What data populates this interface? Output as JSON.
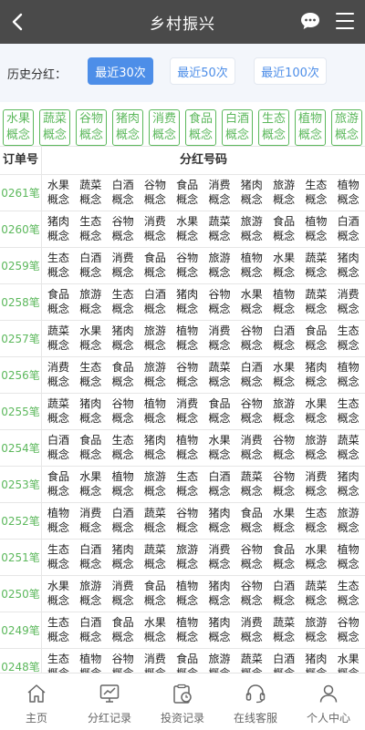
{
  "header": {
    "title": "乡村振兴"
  },
  "history": {
    "label": "历史分红：",
    "options": [
      "最近30次",
      "最近50次",
      "最近100次"
    ],
    "selected": "最近30次"
  },
  "categories": [
    [
      "水果",
      "概念"
    ],
    [
      "蔬菜",
      "概念"
    ],
    [
      "谷物",
      "概念"
    ],
    [
      "猪肉",
      "概念"
    ],
    [
      "消费",
      "概念"
    ],
    [
      "食品",
      "概念"
    ],
    [
      "白酒",
      "概念"
    ],
    [
      "生态",
      "概念"
    ],
    [
      "植物",
      "概念"
    ],
    [
      "旅游",
      "概念"
    ]
  ],
  "table": {
    "headers": {
      "order": "订单号",
      "codes": "分红号码"
    },
    "suffix": "概念",
    "rows": [
      {
        "id": "0261笔",
        "codes": [
          "水果",
          "蔬菜",
          "白酒",
          "谷物",
          "食品",
          "消费",
          "猪肉",
          "旅游",
          "生态",
          "植物"
        ]
      },
      {
        "id": "0260笔",
        "codes": [
          "猪肉",
          "生态",
          "谷物",
          "消费",
          "水果",
          "蔬菜",
          "旅游",
          "食品",
          "植物",
          "白酒"
        ]
      },
      {
        "id": "0259笔",
        "codes": [
          "生态",
          "白酒",
          "消费",
          "食品",
          "谷物",
          "旅游",
          "植物",
          "水果",
          "蔬菜",
          "猪肉"
        ]
      },
      {
        "id": "0258笔",
        "codes": [
          "食品",
          "旅游",
          "生态",
          "白酒",
          "猪肉",
          "谷物",
          "水果",
          "植物",
          "蔬菜",
          "消费"
        ]
      },
      {
        "id": "0257笔",
        "codes": [
          "蔬菜",
          "水果",
          "猪肉",
          "旅游",
          "植物",
          "消费",
          "谷物",
          "白酒",
          "食品",
          "生态"
        ]
      },
      {
        "id": "0256笔",
        "codes": [
          "消费",
          "生态",
          "食品",
          "旅游",
          "谷物",
          "蔬菜",
          "白酒",
          "水果",
          "猪肉",
          "植物"
        ]
      },
      {
        "id": "0255笔",
        "codes": [
          "蔬菜",
          "猪肉",
          "谷物",
          "植物",
          "消费",
          "食品",
          "谷物",
          "旅游",
          "水果",
          "生态"
        ]
      },
      {
        "id": "0254笔",
        "codes": [
          "白酒",
          "食品",
          "生态",
          "猪肉",
          "植物",
          "水果",
          "消费",
          "谷物",
          "旅游",
          "蔬菜"
        ]
      },
      {
        "id": "0253笔",
        "codes": [
          "食品",
          "水果",
          "植物",
          "旅游",
          "生态",
          "白酒",
          "蔬菜",
          "谷物",
          "消费",
          "猪肉"
        ]
      },
      {
        "id": "0252笔",
        "codes": [
          "植物",
          "消费",
          "白酒",
          "蔬菜",
          "谷物",
          "猪肉",
          "食品",
          "水果",
          "生态",
          "旅游"
        ]
      },
      {
        "id": "0251笔",
        "codes": [
          "生态",
          "白酒",
          "猪肉",
          "蔬菜",
          "旅游",
          "消费",
          "谷物",
          "食品",
          "水果",
          "植物"
        ]
      },
      {
        "id": "0250笔",
        "codes": [
          "水果",
          "旅游",
          "消费",
          "食品",
          "植物",
          "猪肉",
          "谷物",
          "白酒",
          "蔬菜",
          "生态"
        ]
      },
      {
        "id": "0249笔",
        "codes": [
          "生态",
          "白酒",
          "食品",
          "水果",
          "植物",
          "猪肉",
          "消费",
          "蔬菜",
          "旅游",
          "谷物"
        ]
      },
      {
        "id": "0248笔",
        "codes": [
          "生态",
          "植物",
          "谷物",
          "消费",
          "食品",
          "旅游",
          "蔬菜",
          "白酒",
          "猪肉",
          "水果"
        ]
      }
    ]
  },
  "tabbar": [
    {
      "label": "主页",
      "icon": "home-icon"
    },
    {
      "label": "分红记录",
      "icon": "chart-icon"
    },
    {
      "label": "投资记录",
      "icon": "clipboard-clock-icon"
    },
    {
      "label": "在线客服",
      "icon": "headset-icon"
    },
    {
      "label": "个人中心",
      "icon": "user-icon"
    }
  ],
  "colors": {
    "header": "#4a4a4a",
    "accent": "#4d8ee8",
    "green": "#5cb85c"
  }
}
